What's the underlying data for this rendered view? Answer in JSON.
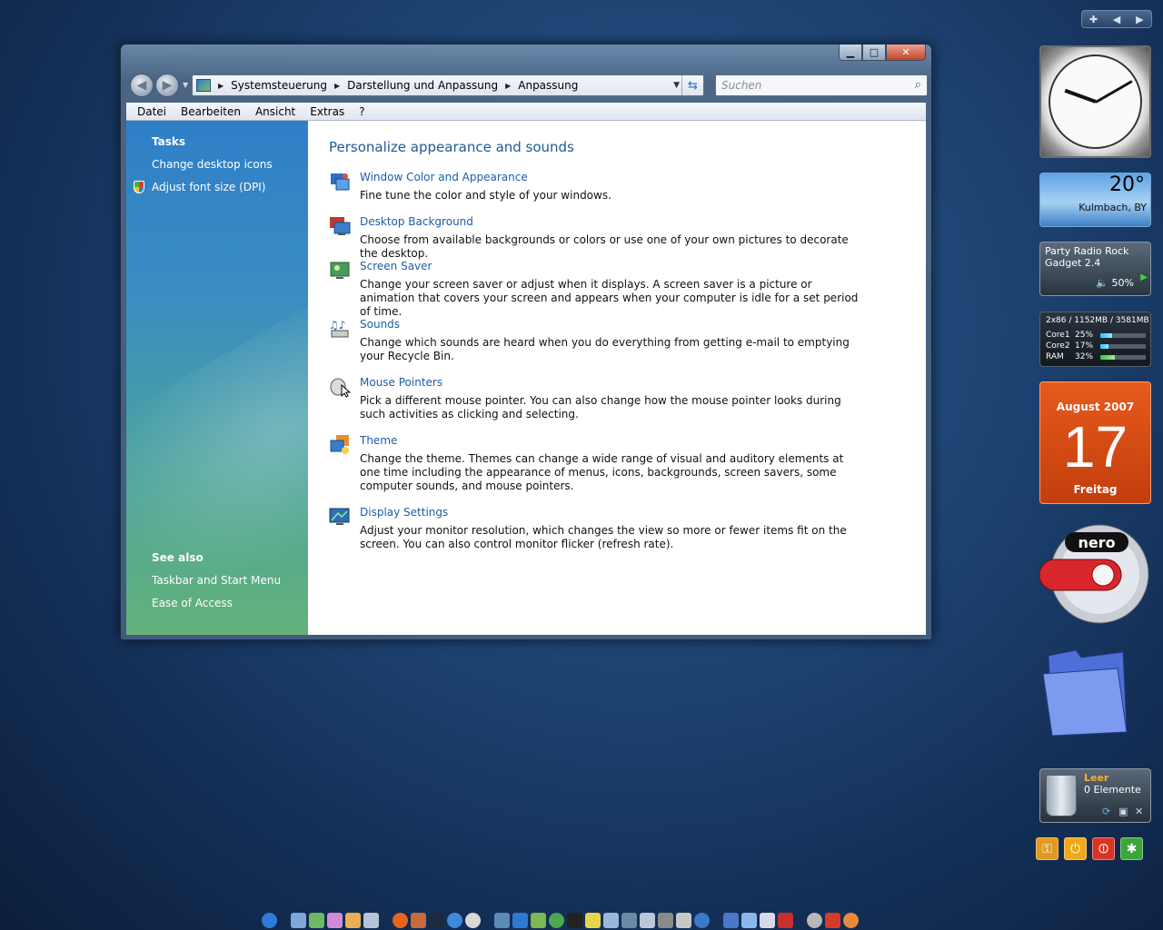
{
  "window": {
    "address": [
      "Systemsteuerung",
      "Darstellung und Anpassung",
      "Anpassung"
    ],
    "search_placeholder": "Suchen",
    "menu": [
      "Datei",
      "Bearbeiten",
      "Ansicht",
      "Extras",
      "?"
    ]
  },
  "sidebar": {
    "tasks_heading": "Tasks",
    "tasks": [
      "Change desktop icons",
      "Adjust font size (DPI)"
    ],
    "see_also_heading": "See also",
    "see_also": [
      "Taskbar and Start Menu",
      "Ease of Access"
    ]
  },
  "content": {
    "heading": "Personalize appearance and sounds",
    "items": [
      {
        "title": "Window Color and Appearance",
        "desc": "Fine tune the color and style of your windows.",
        "icon": "window-color-icon"
      },
      {
        "title": "Desktop Background",
        "desc": "Choose from available backgrounds or colors or use one of your own pictures to decorate the desktop.",
        "icon": "desktop-background-icon"
      },
      {
        "title": "Screen Saver",
        "desc": "Change your screen saver or adjust when it displays. A screen saver is a picture or animation that covers your screen and appears when your computer is idle for a set period of time.",
        "icon": "screen-saver-icon"
      },
      {
        "title": "Sounds",
        "desc": "Change which sounds are heard when you do everything from getting e-mail to emptying your Recycle Bin.",
        "icon": "sounds-icon"
      },
      {
        "title": "Mouse Pointers",
        "desc": "Pick a different mouse pointer. You can also change how the mouse pointer looks during such activities as clicking and selecting.",
        "icon": "mouse-pointer-icon"
      },
      {
        "title": "Theme",
        "desc": "Change the theme. Themes can change a wide range of visual and auditory elements at one time including the appearance of menus, icons, backgrounds, screen savers, some computer sounds, and mouse pointers.",
        "icon": "theme-icon"
      },
      {
        "title": "Display Settings",
        "desc": "Adjust your monitor resolution, which changes the view so more or fewer items fit on the screen. You can also control monitor flicker (refresh rate).",
        "icon": "display-settings-icon"
      }
    ]
  },
  "gadgets": {
    "weather": {
      "temp": "20°",
      "location": "Kulmbach, BY"
    },
    "radio": {
      "name": "Party Radio Rock Gadget 2.4",
      "volume": "50%"
    },
    "cpu": {
      "header": "2x86 / 1152MB / 3581MB",
      "rows": [
        {
          "label": "Core1",
          "value": "25%",
          "fraction": 0.25
        },
        {
          "label": "Core2",
          "value": "17%",
          "fraction": 0.17
        },
        {
          "label": "RAM",
          "value": "32%",
          "fraction": 0.32
        }
      ]
    },
    "calendar": {
      "month": "August 2007",
      "day": "17",
      "weekday": "Freitag"
    },
    "nero_label": "nero",
    "recycle": {
      "status": "Leer",
      "count": "0 Elemente"
    }
  },
  "colors": {
    "link": "#1f5ca8",
    "heading": "#1e5a96",
    "calendar": "#d84a14"
  }
}
